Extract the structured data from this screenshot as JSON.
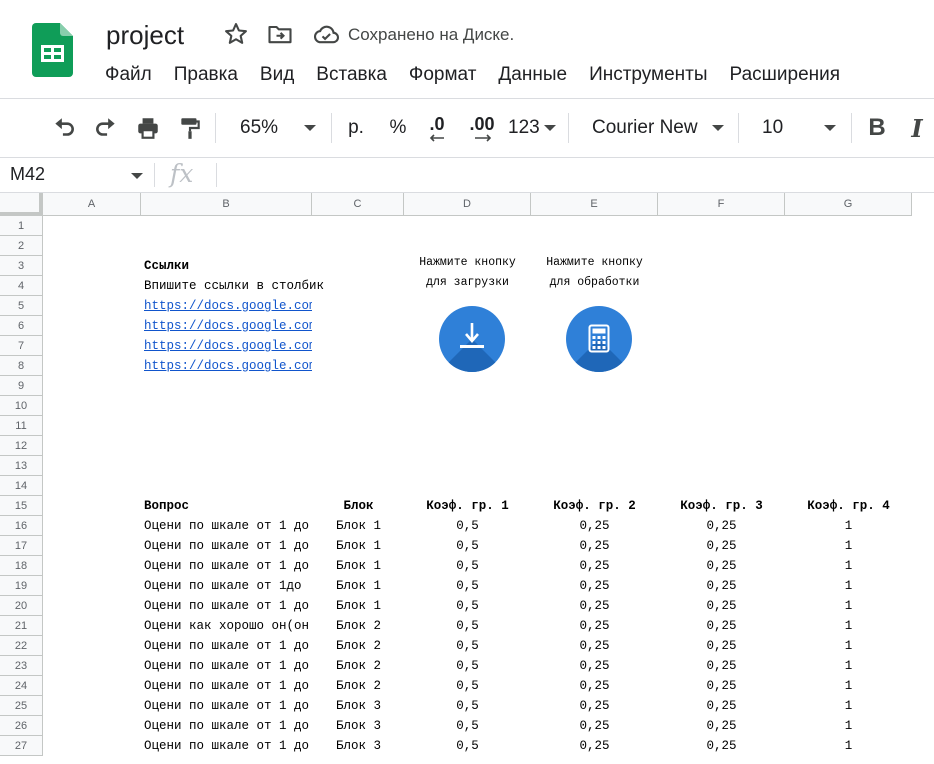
{
  "app": {
    "title": "project",
    "save_status": "Сохранено на Диске."
  },
  "menu": [
    "Файл",
    "Правка",
    "Вид",
    "Вставка",
    "Формат",
    "Данные",
    "Инструменты",
    "Расширения"
  ],
  "toolbar": {
    "zoom": "65%",
    "currency_label": "р.",
    "percent_label": "%",
    "decrease_decimals_label": ".0",
    "increase_decimals_label": ".00",
    "more_formats_label": "123",
    "font": "Courier New",
    "font_size": "10",
    "bold_label": "B",
    "italic_label": "I"
  },
  "formula_bar": {
    "cell_ref": "M42",
    "fx_label": "fx",
    "value": ""
  },
  "colors": {
    "sheets_green": "#0f9d58",
    "link_blue": "#1155cc",
    "button_blue": "#2f80d8"
  },
  "grid": {
    "columns": [
      "A",
      "B",
      "C",
      "D",
      "E",
      "F",
      "G"
    ],
    "rows": [
      "1",
      "2",
      "3",
      "4",
      "5",
      "6",
      "7",
      "8",
      "9",
      "10",
      "11",
      "12",
      "13",
      "14",
      "15",
      "16",
      "17",
      "18",
      "19",
      "20",
      "21",
      "22",
      "23",
      "24",
      "25",
      "26",
      "27"
    ]
  },
  "links_section": {
    "title": "Ссылки",
    "hint": "Впишите ссылки в столбик",
    "links": [
      "https://docs.google.com",
      "https://docs.google.com",
      "https://docs.google.com",
      "https://docs.google.com"
    ]
  },
  "buttons": {
    "download": {
      "line1": "Нажмите кнопку",
      "line2": "для загрузки",
      "icon": "download-icon"
    },
    "process": {
      "line1": "Нажмите кнопку",
      "line2": "для обработки",
      "icon": "calculator-icon"
    }
  },
  "table": {
    "headers": [
      "Вопрос",
      "Блок",
      "Коэф. гр. 1",
      "Коэф. гр. 2",
      "Коэф. гр. 3",
      "Коэф. гр. 4"
    ],
    "rows": [
      [
        "Оцени по шкале от 1 до",
        "Блок 1",
        "0,5",
        "0,25",
        "0,25",
        "1"
      ],
      [
        "Оцени по шкале от 1 до",
        "Блок 1",
        "0,5",
        "0,25",
        "0,25",
        "1"
      ],
      [
        "Оцени по шкале от 1 до",
        "Блок 1",
        "0,5",
        "0,25",
        "0,25",
        "1"
      ],
      [
        "Оцени по шкале от 1до",
        "Блок 1",
        "0,5",
        "0,25",
        "0,25",
        "1"
      ],
      [
        "Оцени по шкале от 1 до",
        "Блок 1",
        "0,5",
        "0,25",
        "0,25",
        "1"
      ],
      [
        "Оцени как хорошо он(он",
        "Блок 2",
        "0,5",
        "0,25",
        "0,25",
        "1"
      ],
      [
        "Оцени по шкале от 1 до",
        "Блок 2",
        "0,5",
        "0,25",
        "0,25",
        "1"
      ],
      [
        "Оцени по шкале от 1 до",
        "Блок 2",
        "0,5",
        "0,25",
        "0,25",
        "1"
      ],
      [
        "Оцени по шкале от 1 до",
        "Блок 2",
        "0,5",
        "0,25",
        "0,25",
        "1"
      ],
      [
        "Оцени по шкале от 1 до",
        "Блок 3",
        "0,5",
        "0,25",
        "0,25",
        "1"
      ],
      [
        "Оцени по шкале от 1 до",
        "Блок 3",
        "0,5",
        "0,25",
        "0,25",
        "1"
      ],
      [
        "Оцени по шкале от 1 до",
        "Блок 3",
        "0,5",
        "0,25",
        "0,25",
        "1"
      ]
    ]
  }
}
